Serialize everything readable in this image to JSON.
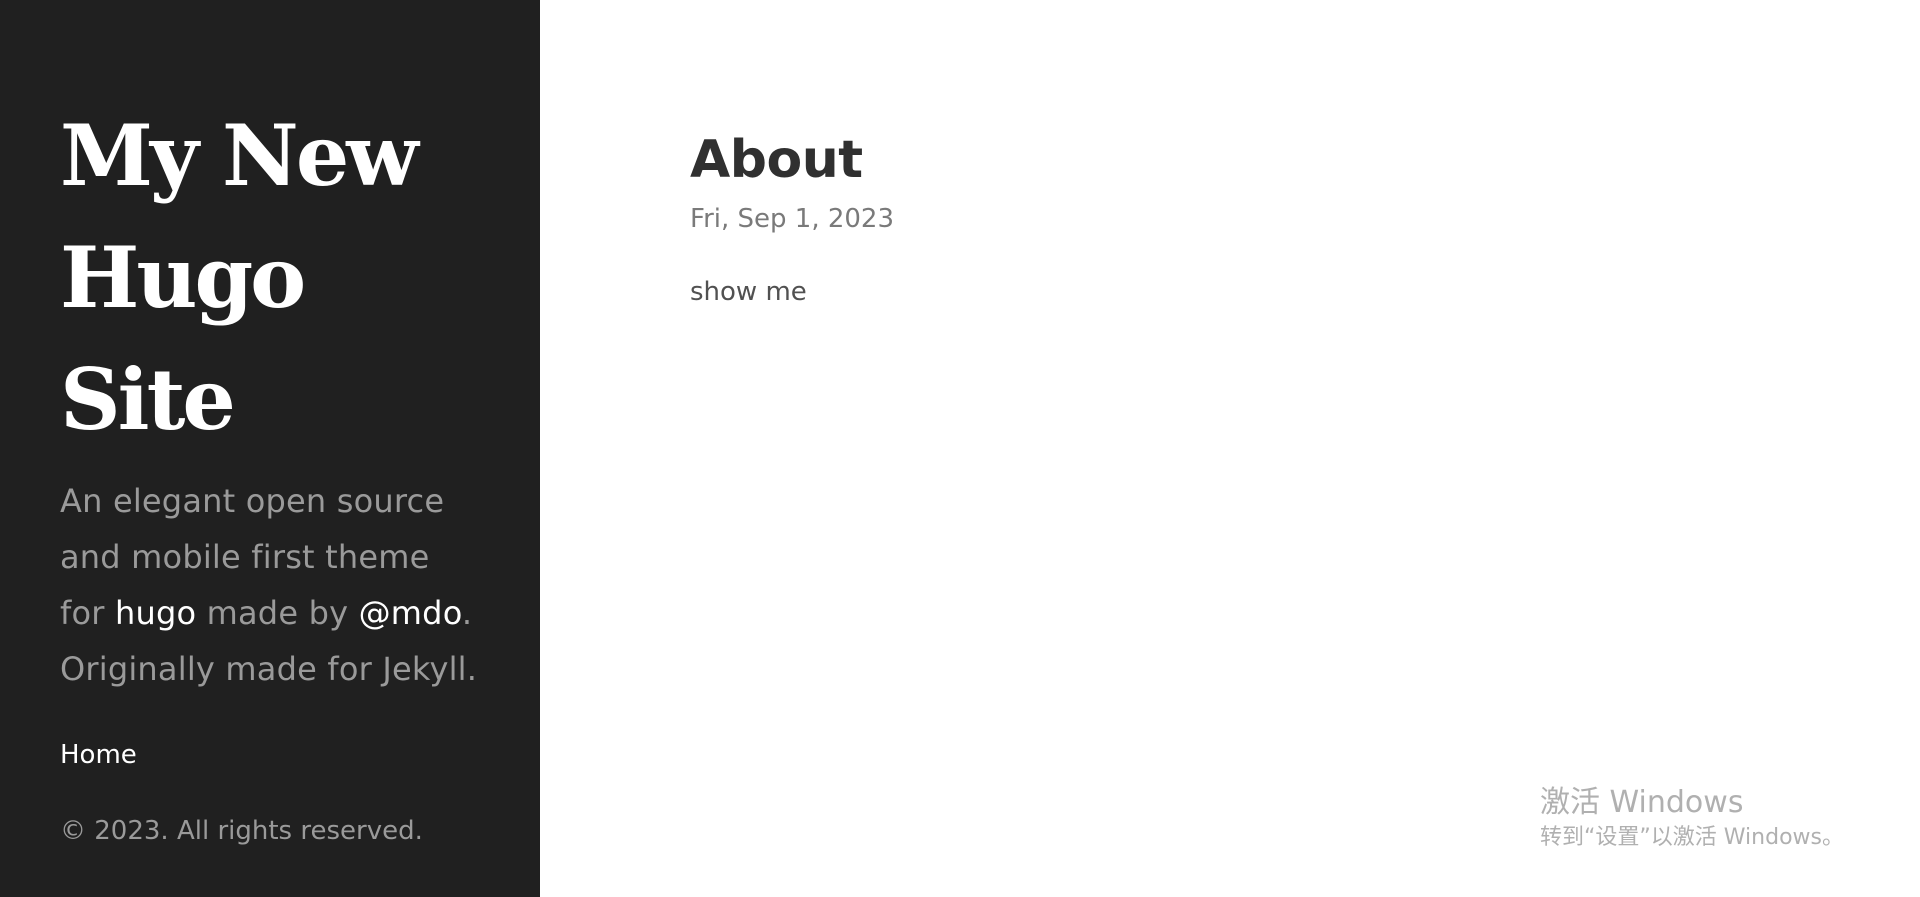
{
  "sidebar": {
    "site_title_lines": [
      "My New",
      "Hugo",
      "Site"
    ],
    "lead": {
      "text_1": "An elegant open source and mobile first theme for ",
      "link_hugo": "hugo",
      "text_2": " made by ",
      "link_mdo": "@mdo",
      "text_3": ". Originally made for Jekyll."
    },
    "nav_items": [
      {
        "label": "Home"
      }
    ],
    "copyright": "© 2023. All rights reserved."
  },
  "post": {
    "title": "About",
    "date": "Fri, Sep 1, 2023",
    "body": "show me"
  },
  "watermark": {
    "title": "激活 Windows",
    "subtitle": "转到“设置”以激活 Windows。"
  },
  "colors": {
    "sidebar_bg": "#202020",
    "sidebar_text": "#9a9a9a",
    "link": "#ffffff",
    "title_text": "#303030",
    "body_text": "#515151"
  }
}
